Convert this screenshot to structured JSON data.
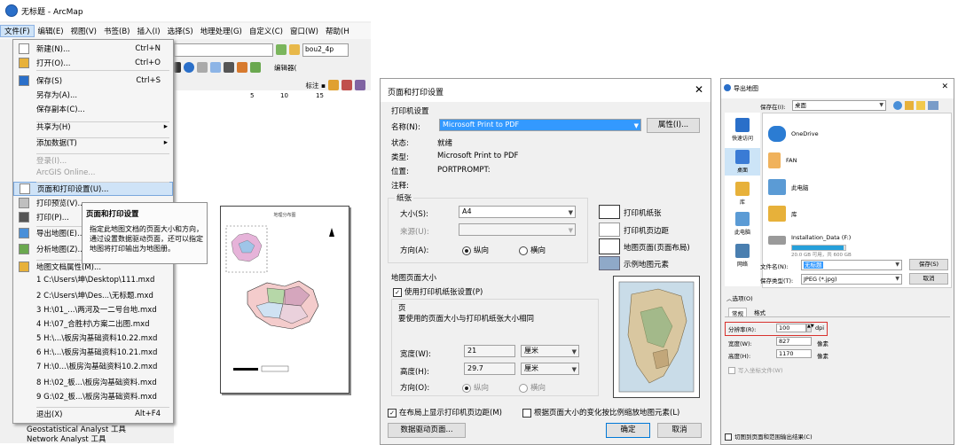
{
  "arcmap": {
    "window_title": "无标题 - ArcMap",
    "menu": [
      "文件(F)",
      "编辑(E)",
      "视图(V)",
      "书签(B)",
      "插入(I)",
      "选择(S)",
      "地理处理(G)",
      "自定义(C)",
      "窗口(W)",
      "帮助(H"
    ],
    "toolbar": {
      "layer_name": "bou2_4p",
      "editor_label": "编辑器(",
      "annotate_label": "标注 ▪"
    },
    "ruler": [
      "5",
      "10",
      "15"
    ],
    "file_menu": [
      {
        "label": "新建(N)...",
        "shortcut": "Ctrl+N"
      },
      {
        "label": "打开(O)...",
        "shortcut": "Ctrl+O"
      },
      {
        "label": "保存(S)",
        "shortcut": "Ctrl+S"
      },
      {
        "label": "另存为(A)...",
        "shortcut": ""
      },
      {
        "label": "保存副本(C)...",
        "shortcut": ""
      },
      {
        "label": "共享为(H)",
        "shortcut": ""
      },
      {
        "label": "添加数据(T)",
        "shortcut": ""
      },
      {
        "label": "登录(I)...",
        "shortcut": ""
      },
      {
        "label": "ArcGIS Online...",
        "shortcut": ""
      },
      {
        "label": "页面和打印设置(U)...",
        "shortcut": ""
      },
      {
        "label": "打印预览(V)...",
        "shortcut": ""
      },
      {
        "label": "打印(P)...",
        "shortcut": ""
      },
      {
        "label": "导出地图(E)...",
        "shortcut": ""
      },
      {
        "label": "分析地图(Z)...",
        "shortcut": ""
      },
      {
        "label": "地图文档属性(M)...",
        "shortcut": ""
      },
      {
        "label": "1 C:\\Users\\坤\\Desktop\\111.mxd",
        "shortcut": ""
      },
      {
        "label": "2 C:\\Users\\坤\\Des...\\无标题.mxd",
        "shortcut": ""
      },
      {
        "label": "3 H:\\01_...\\两河及一二号台地.mxd",
        "shortcut": ""
      },
      {
        "label": "4 H:\\07_合胜村\\方案二出图.mxd",
        "shortcut": ""
      },
      {
        "label": "5 H:\\...\\板房沟基础资料10.22.mxd",
        "shortcut": ""
      },
      {
        "label": "6 H:\\...\\板房沟基础资料10.21.mxd",
        "shortcut": ""
      },
      {
        "label": "7 H:\\0...\\板房沟基础资料10.2.mxd",
        "shortcut": ""
      },
      {
        "label": "8 H:\\02_板...\\板房沟基础资料.mxd",
        "shortcut": ""
      },
      {
        "label": "9 G:\\02_板...\\板房沟基础资料.mxd",
        "shortcut": ""
      },
      {
        "label": "退出(X)",
        "shortcut": "Alt+F4"
      }
    ],
    "tooltip": {
      "title": "页面和打印设置",
      "body": "指定此地图文档的页面大小和方向，通过设置数据驱动页面，还可以指定地图将打印输出为地图册。"
    },
    "toc": [
      "Geostatistical Analyst 工具",
      "Network Analyst 工具"
    ],
    "layout_page_title": "地理分布图"
  },
  "page_setup": {
    "title": "页面和打印设置",
    "printer_section": "打印机设置",
    "name_label": "名称(N):",
    "printer_name": "Microsoft Print to PDF",
    "properties_button": "属性(I)...",
    "status_label": "状态:",
    "status_value": "就绪",
    "type_label": "类型:",
    "type_value": "Microsoft Print to PDF",
    "where_label": "位置:",
    "where_value": "PORTPROMPT:",
    "comment_label": "注释:",
    "paper_section": "纸张",
    "size_label": "大小(S):",
    "size_value": "A4",
    "source_label": "来源(U):",
    "orient_label": "方向(A):",
    "orient_portrait": "纵向",
    "orient_landscape": "横向",
    "legend": [
      "打印机纸张",
      "打印机页边距",
      "地图页面(页面布局)",
      "示例地图元素"
    ],
    "map_page_section": "地图页面大小",
    "use_printer_paper": "使用打印机纸张设置(P)",
    "page_label": "页",
    "page_note": "要使用的页面大小与打印机纸张大小相同",
    "width_label": "宽度(W):",
    "width_value": "21",
    "width_unit": "厘米",
    "height_label": "高度(H):",
    "height_value": "29.7",
    "height_unit": "厘米",
    "orient2_label": "方向(O):",
    "show_margins": "在布局上显示打印机页边距(M)",
    "scale_elements": "根据页面大小的变化按比例缩放地图元素(L)",
    "ddp_button": "数据驱动页面...",
    "ok_button": "确定",
    "cancel_button": "取消"
  },
  "export": {
    "title": "导出地图",
    "save_in_label": "保存在(I):",
    "save_in_value": "桌面",
    "nav": [
      "快速访问",
      "桌面",
      "库",
      "此电脑",
      "网络"
    ],
    "files": [
      "OneDrive",
      "FAN",
      "此电脑",
      "库",
      "Installation_Data (F:)",
      "20.0 GB 可用，共 600 GB"
    ],
    "filename_label": "文件名(N):",
    "filename_value": "无标题",
    "filetype_label": "保存类型(T):",
    "filetype_value": "JPEG (*.jpg)",
    "save_button": "保存(S)",
    "cancel_button": "取消",
    "options_label": "选项(O)",
    "tabs": [
      "常规",
      "格式"
    ],
    "resolution_label": "分辨率(R):",
    "resolution_value": "100",
    "resolution_unit": "dpi",
    "width_label": "宽度(W):",
    "width_value": "827",
    "width_unit": "像素",
    "height_label": "高度(H):",
    "height_value": "1170",
    "height_unit": "像素",
    "world_file": "写入坐标文件(W)",
    "clip_output": "切图到页面和范围输出结果(C)"
  },
  "colors": {
    "highlight": "#cfe3f7",
    "selection": "#3399ff",
    "accent_red": "#d8322e"
  }
}
